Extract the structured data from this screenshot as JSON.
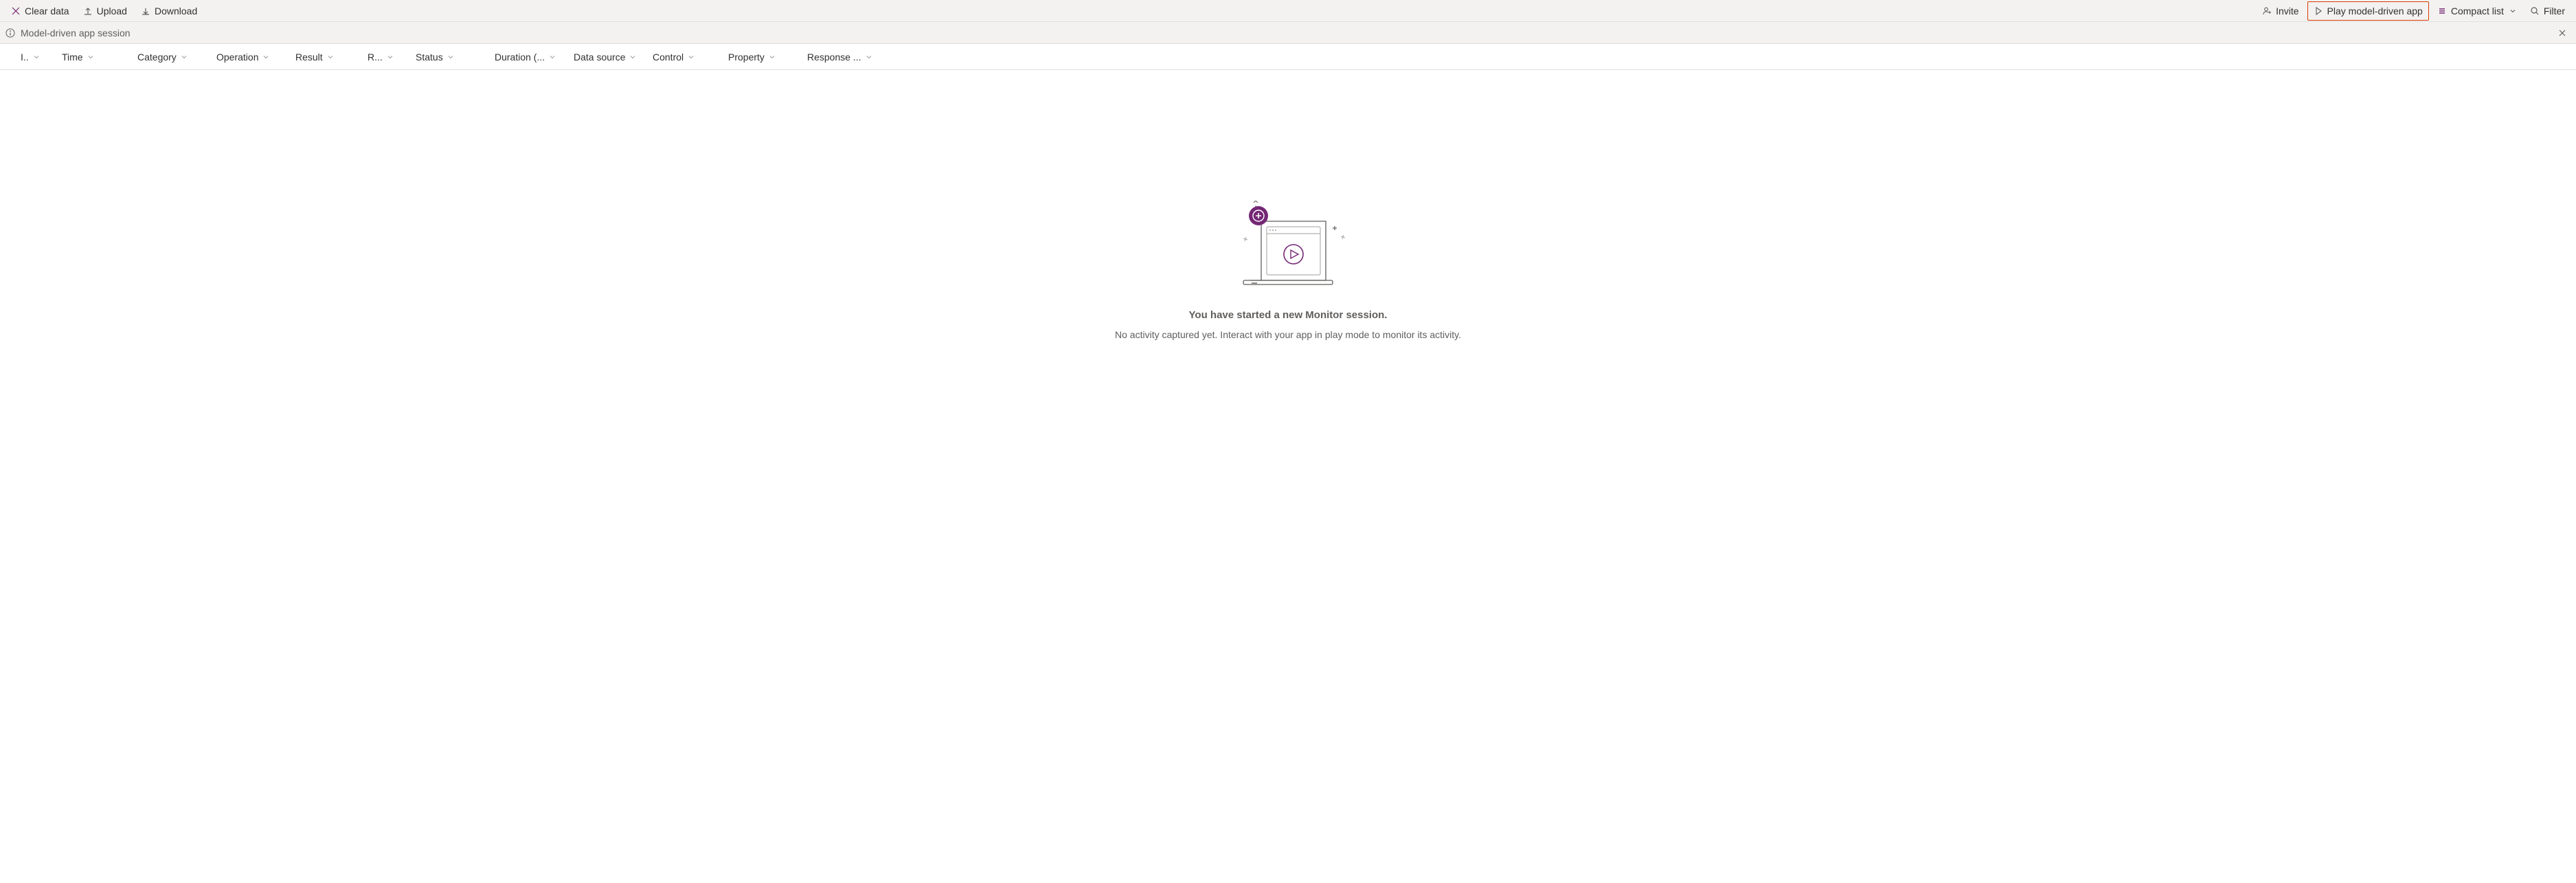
{
  "toolbar": {
    "clear_data": "Clear data",
    "upload": "Upload",
    "download": "Download",
    "invite": "Invite",
    "play": "Play model-driven app",
    "compact_list": "Compact list",
    "filter": "Filter"
  },
  "session": {
    "label": "Model-driven app session"
  },
  "columns": {
    "id": "I..",
    "time": "Time",
    "category": "Category",
    "operation": "Operation",
    "result": "Result",
    "r_short": "R...",
    "status": "Status",
    "duration": "Duration (...",
    "data_source": "Data source",
    "control": "Control",
    "property": "Property",
    "response": "Response ..."
  },
  "empty": {
    "title": "You have started a new Monitor session.",
    "subtitle": "No activity captured yet. Interact with your app in play mode to monitor its activity."
  },
  "colors": {
    "accent": "#742774",
    "highlight": "#d83b01"
  }
}
